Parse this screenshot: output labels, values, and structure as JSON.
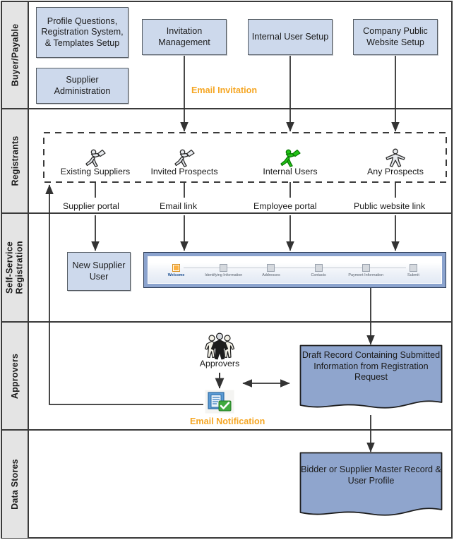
{
  "diagram": {
    "title": "Supplier Registration Process Swimlane Diagram",
    "colors": {
      "box_fill": "#cdd9ec",
      "box_border": "#555c63",
      "lane_header_fill": "#e4e4e4",
      "frame_border": "#3a3a3a",
      "accent_orange": "#f5a623",
      "internal_user_green": "#22c416",
      "wizard_header": "#8ba3ce",
      "wizard_active_step": "#fcb040"
    }
  },
  "lanes": [
    {
      "id": "buyer-payable",
      "label": "Buyer/Payable"
    },
    {
      "id": "registrants",
      "label": "Registrants"
    },
    {
      "id": "self-service",
      "label": "Self-Service\nRegistration"
    },
    {
      "id": "approvers",
      "label": "Approvers"
    },
    {
      "id": "data-stores",
      "label": "Data Stores"
    }
  ],
  "buyer_lane": {
    "boxes": [
      {
        "id": "profile-questions",
        "label": "Profile Questions, Registration System, & Templates Setup"
      },
      {
        "id": "supplier-admin",
        "label": "Supplier Administration"
      },
      {
        "id": "invitation-mgmt",
        "label": "Invitation Management"
      },
      {
        "id": "internal-user-setup",
        "label": "Internal User Setup"
      },
      {
        "id": "company-website",
        "label": "Company Public Website Setup"
      }
    ],
    "flow_label": "Email Invitation"
  },
  "registrants_lane": {
    "actors": [
      {
        "id": "existing-suppliers",
        "label": "Existing Suppliers",
        "icon": "person-with-briefcase-icon",
        "color": "#d9dde3"
      },
      {
        "id": "invited-prospects",
        "label": "Invited Prospects",
        "icon": "person-with-briefcase-icon",
        "color": "#d9dde3"
      },
      {
        "id": "internal-users",
        "label": "Internal Users",
        "icon": "person-with-briefcase-icon",
        "color": "#22c416"
      },
      {
        "id": "any-prospects",
        "label": "Any Prospects",
        "icon": "person-icon",
        "color": "#d9dde3"
      }
    ],
    "channel_labels": [
      "Supplier portal",
      "Email link",
      "Employee portal",
      "Public website link"
    ]
  },
  "self_service_lane": {
    "new_supplier_box": {
      "id": "new-supplier-user",
      "label": "New Supplier User"
    },
    "wizard": {
      "steps": [
        {
          "label": "Welcome",
          "active": true
        },
        {
          "label": "Identifying Information",
          "active": false
        },
        {
          "label": "Addresses",
          "active": false
        },
        {
          "label": "Contacts",
          "active": false
        },
        {
          "label": "Payment Information",
          "active": false
        },
        {
          "label": "Submit",
          "active": false
        }
      ]
    }
  },
  "approvers_lane": {
    "approvers_actor": {
      "id": "approvers-group",
      "label": "Approvers",
      "icon": "people-group-icon"
    },
    "email_icon": {
      "id": "email-notification",
      "icon": "document-check-icon"
    },
    "email_label": "Email Notification",
    "draft_record": {
      "id": "draft-record",
      "label": "Draft Record Containing Submitted Information from Registration Request"
    }
  },
  "data_stores_lane": {
    "master_record": {
      "id": "bidder-supplier-master",
      "label": "Bidder or Supplier Master Record & User Profile"
    }
  }
}
